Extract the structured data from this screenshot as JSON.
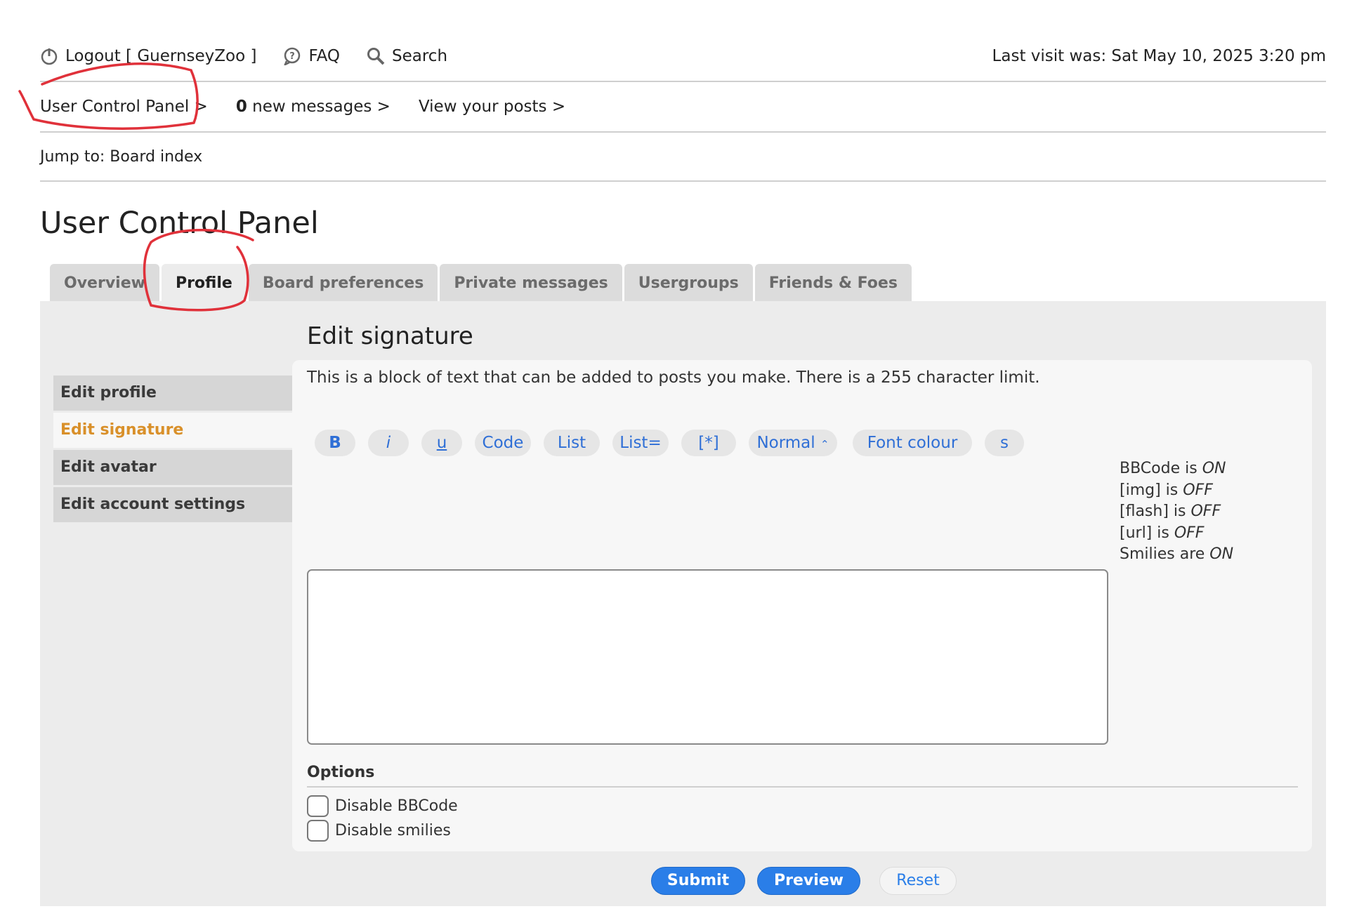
{
  "nav": {
    "logout": "Logout [ GuernseyZoo ]",
    "faq": "FAQ",
    "search": "Search",
    "last_visit": "Last visit was: Sat May 10, 2025 3:20 pm"
  },
  "subnav": {
    "ucp": "User Control Panel >",
    "new_count": "0",
    "new_messages": " new messages >",
    "view_posts": "View your posts >"
  },
  "jump": "Jump to: Board index",
  "page_title": "User Control Panel",
  "tabs": [
    "Overview",
    "Profile",
    "Board preferences",
    "Private messages",
    "Usergroups",
    "Friends & Foes"
  ],
  "sidebar": [
    "Edit profile",
    "Edit signature",
    "Edit avatar",
    "Edit account settings"
  ],
  "section_title": "Edit signature",
  "description": "This is a block of text that can be added to posts you make. There is a 255 character limit.",
  "toolbar": {
    "bold": "B",
    "italic": "i",
    "underline": "u",
    "code": "Code",
    "list": "List",
    "list_eq": "List=",
    "star": "[*]",
    "size": "Normal",
    "colour": "Font colour",
    "strike": "s"
  },
  "status": {
    "bbcode_label": "BBCode is ",
    "bbcode_value": "ON",
    "img_label": "[img] is ",
    "img_value": "OFF",
    "flash_label": "[flash] is ",
    "flash_value": "OFF",
    "url_label": "[url] is ",
    "url_value": "OFF",
    "smilies_label": "Smilies are ",
    "smilies_value": "ON"
  },
  "options": {
    "title": "Options",
    "disable_bbcode": "Disable BBCode",
    "disable_smilies": "Disable smilies"
  },
  "buttons": {
    "submit": "Submit",
    "preview": "Preview",
    "reset": "Reset"
  },
  "colors": {
    "accent": "#2a7ee8",
    "active_side": "#d9902a",
    "annotation": "#e0313a"
  }
}
